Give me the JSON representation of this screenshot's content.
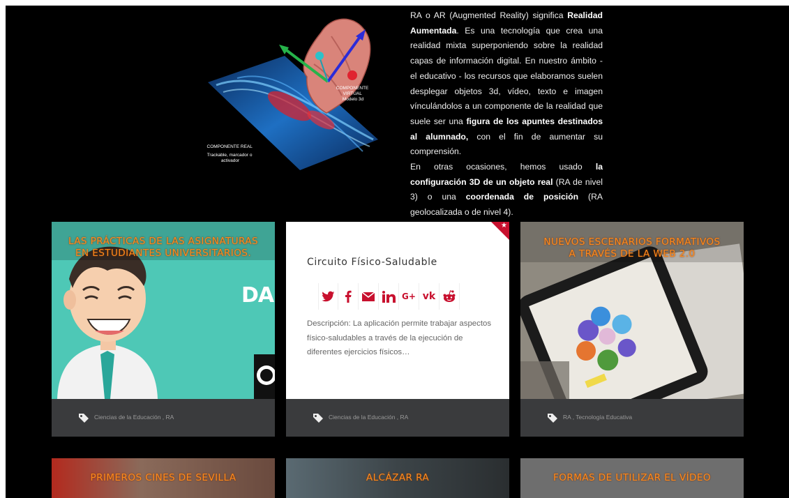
{
  "intro": {
    "illustration": {
      "virtual_label": [
        "COMPONENTE",
        "VIRTUAL",
        "Modelo 3d"
      ],
      "real_label": [
        "COMPONENTE REAL"
      ],
      "real_sublabel": [
        "Trackable, marcador o",
        "activador"
      ]
    },
    "paragraph1": {
      "t1": "RA o AR (Augmented Reality) significa ",
      "b1": "Realidad Aumentada",
      "t2": ". Es una tecnología que crea una realidad mixta superponiendo sobre la realidad capas de información digital. En nuestro ámbito - el educativo - los recursos que elaboramos suelen desplegar objetos 3d, vídeo, texto e imagen vínculándolos a un componente de la realidad que suele ser una ",
      "b2": "figura de los apuntes destinados al alumnado,",
      "t3": " con el fin de aumentar su comprensión."
    },
    "paragraph2": {
      "t1": "En otras ocasiones, hemos usado ",
      "b1": "la configuración 3D de un objeto real",
      "t2": " (RA de nivel 3) o una ",
      "b2": "coordenada de posición",
      "t3": " (RA geolocalizada o de nivel 4)."
    }
  },
  "cards": [
    {
      "title_lines": [
        "LAS PRÁCTICAS DE LAS ASIGNATURAS",
        "EN ESTUDIANTES UNIVERSITARIOS."
      ],
      "thumb_text": "DAFO",
      "tags": "Ciencias de la Educación , RA"
    },
    {
      "detail_title": "Circuito Físico-Saludable",
      "share_icons": [
        "twitter-icon",
        "facebook-icon",
        "email-icon",
        "linkedin-icon",
        "google-plus-icon",
        "vk-icon",
        "reddit-icon"
      ],
      "description": "Descripción: La aplicación permite trabajar aspectos físico-saludables a través de la ejecución de diferentes ejercicios físicos…",
      "tags": "Ciencias de la Educación , RA"
    },
    {
      "title_lines": [
        "NUEVOS ESCENARIOS FORMATIVOS",
        "A TRAVÉS DE LA WEB 2.0"
      ],
      "tags": "RA , Tecnología Educativa"
    }
  ],
  "bottom_cards": [
    {
      "title": "PRIMEROS CINES DE SEVILLA"
    },
    {
      "title": "ALCÁZAR RA"
    },
    {
      "title": "FORMAS DE UTILIZAR EL VÍDEO"
    }
  ],
  "colors": {
    "accent_red": "#c8102e",
    "title_orange": "#ff8a1c",
    "footer_gray": "#3a3b3d"
  }
}
